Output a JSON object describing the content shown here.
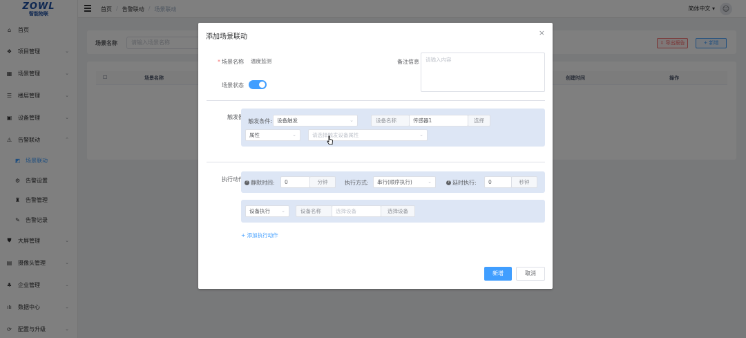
{
  "logo": {
    "main": "ZOWL",
    "sub": "智能物联"
  },
  "sidebar": {
    "items": [
      {
        "label": "首页",
        "icon": "home-icon",
        "arrow": ""
      },
      {
        "label": "项目管理",
        "icon": "project-icon",
        "arrow": "⌄"
      },
      {
        "label": "场景管理",
        "icon": "scene-icon",
        "arrow": "⌄"
      },
      {
        "label": "楼层管理",
        "icon": "floor-icon",
        "arrow": "⌄"
      },
      {
        "label": "设备管理",
        "icon": "device-icon",
        "arrow": "⌄"
      },
      {
        "label": "告警联动",
        "icon": "alarm-icon",
        "arrow": "⌃"
      },
      {
        "label": "场景联动",
        "icon": "link-icon",
        "arrow": ""
      },
      {
        "label": "告警设置",
        "icon": "setting-icon",
        "arrow": ""
      },
      {
        "label": "告警管理",
        "icon": "bell-icon",
        "arrow": ""
      },
      {
        "label": "告警记录",
        "icon": "record-icon",
        "arrow": ""
      },
      {
        "label": "大屏管理",
        "icon": "screen-icon",
        "arrow": "⌄"
      },
      {
        "label": "摄像头管理",
        "icon": "camera-icon",
        "arrow": "⌄"
      },
      {
        "label": "企业管理",
        "icon": "company-icon",
        "arrow": "⌄"
      },
      {
        "label": "数据中心",
        "icon": "data-icon",
        "arrow": "⌄"
      },
      {
        "label": "配置与升级",
        "icon": "upgrade-icon",
        "arrow": "⌄"
      }
    ]
  },
  "header": {
    "breadcrumb": [
      "首页",
      "告警联动",
      "场景联动"
    ],
    "lang": "简体中文 ▾"
  },
  "page": {
    "search_label": "场景名称",
    "search_placeholder": "请输入场景名称",
    "import_label": "⇩ 导出报告",
    "add_label": "+ 新增",
    "columns": [
      "场景名称",
      "创建时间",
      "操作"
    ]
  },
  "dialog": {
    "title": "添加场景联动",
    "close": "×",
    "scene_name_label": "场景名称",
    "scene_name_value": "温度监测",
    "remark_label": "备注信息",
    "remark_placeholder": "请输入内容",
    "status_label": "场景状态",
    "trigger_label": "触发器",
    "trigger_cond_label": "触发条件:",
    "trigger_cond_value": "设备触发",
    "trigger_device_label": "设备名称",
    "trigger_device_value": "传感器1",
    "trigger_device_btn": "选择",
    "attr_value": "属性",
    "attr_placeholder": "请选择触发设备属性",
    "action_label": "执行动作",
    "silence_label": "静默时间:",
    "silence_value": "0",
    "silence_unit": "分钟",
    "exec_mode_label": "执行方式:",
    "exec_mode_value": "串行(顺序执行)",
    "delay_label": "延时执行:",
    "delay_value": "0",
    "delay_unit": "秒钟",
    "device_exec_value": "设备执行",
    "device_name_label": "设备名称",
    "device_name_placeholder": "选择设备",
    "device_select_btn": "选择设备",
    "add_action_link": "+ 添加执行动作",
    "submit_label": "新增",
    "cancel_label": "取消"
  }
}
